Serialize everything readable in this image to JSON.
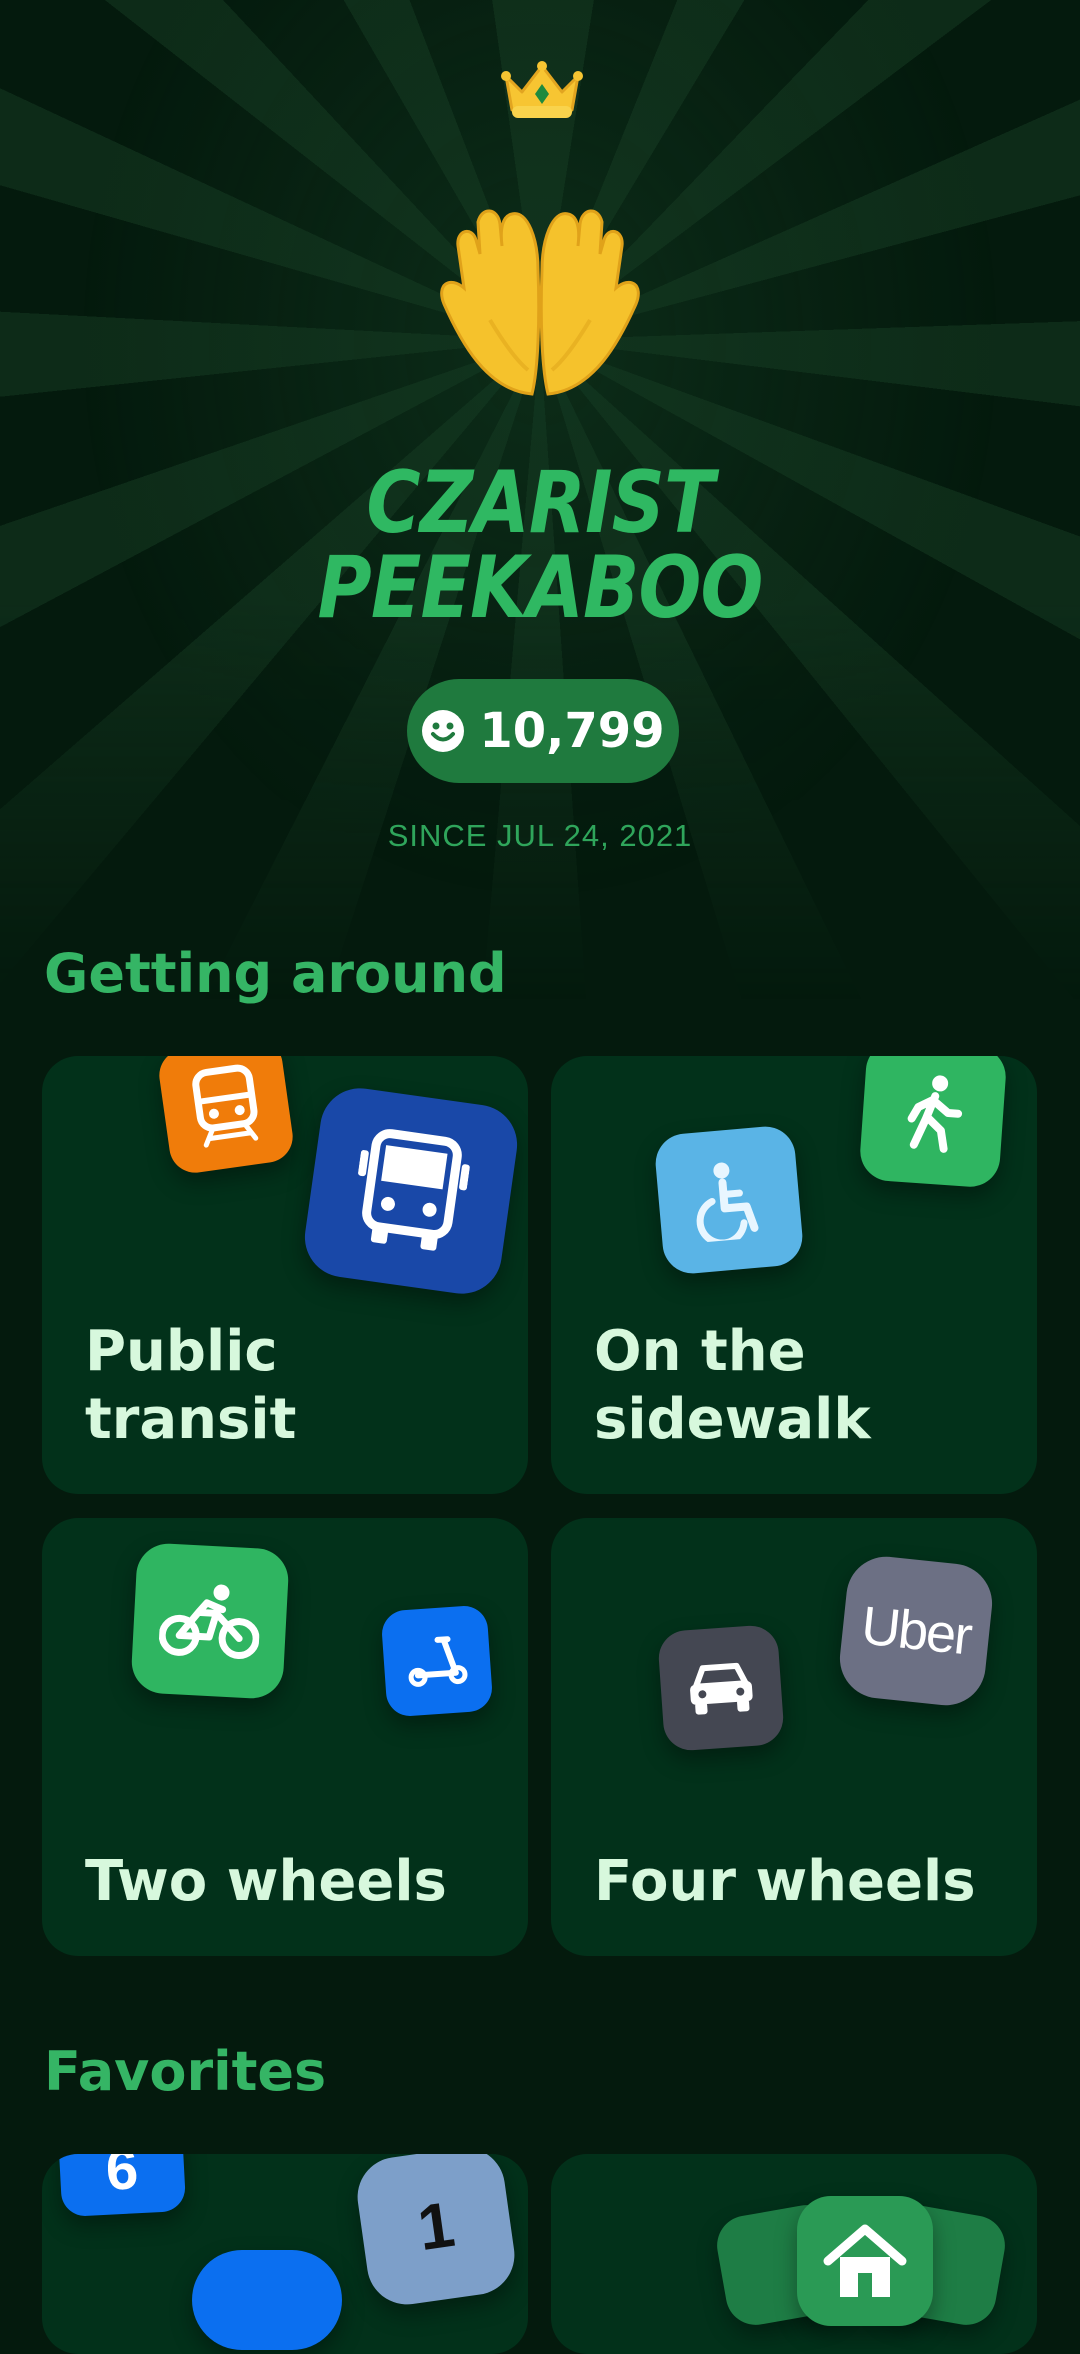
{
  "profile": {
    "name_line1": "CZARIST",
    "name_line2": "PEEKABOO",
    "points": "10,799",
    "since": "SINCE JUL 24, 2021"
  },
  "sections": {
    "getting_around": "Getting around",
    "favorites": "Favorites"
  },
  "categories": [
    {
      "label_line1": "Public",
      "label_line2": "transit",
      "icons": [
        "train-icon",
        "bus-icon"
      ]
    },
    {
      "label_line1": "On the",
      "label_line2": "sidewalk",
      "icons": [
        "wheelchair-icon",
        "walking-icon"
      ]
    },
    {
      "label": "Two wheels",
      "icons": [
        "bike-icon",
        "scooter-icon"
      ]
    },
    {
      "label": "Four wheels",
      "icons": [
        "car-icon",
        "uber-icon"
      ],
      "uber_text": "Uber"
    }
  ],
  "favorites": {
    "line_badges": [
      "6",
      "1"
    ]
  },
  "colors": {
    "background": "#041a0d",
    "card": "#02311a",
    "accent_green": "#2fb862",
    "points_pill": "#1f7a3e",
    "label_text": "#d7f8dd"
  }
}
